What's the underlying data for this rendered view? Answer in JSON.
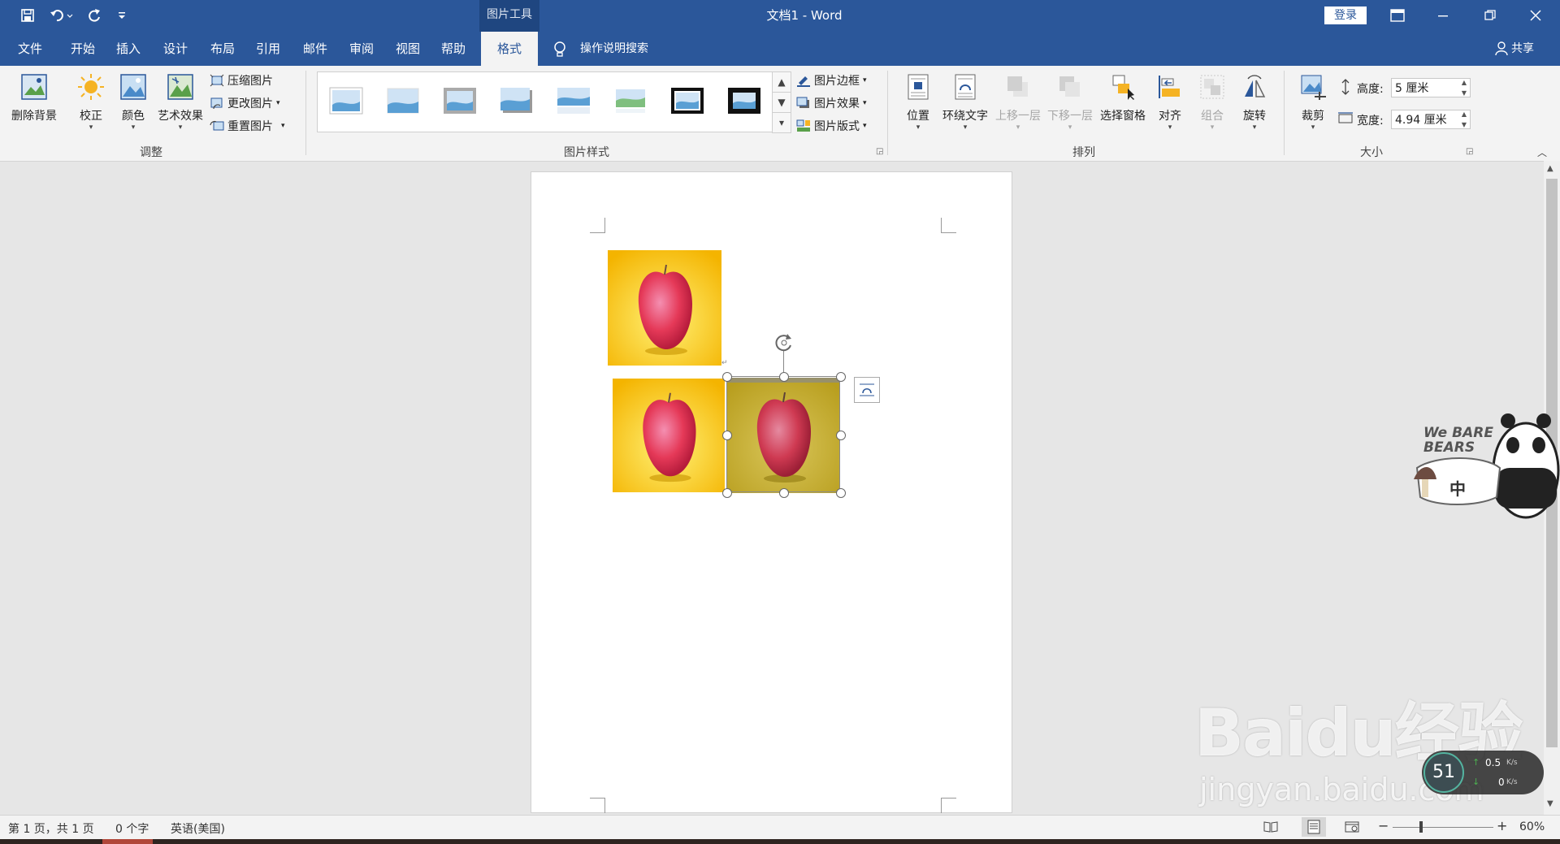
{
  "window": {
    "title": "文档1 - Word",
    "context_tab_group": "图片工具",
    "login_label": "登录"
  },
  "menu": {
    "tabs": [
      "文件",
      "开始",
      "插入",
      "设计",
      "布局",
      "引用",
      "邮件",
      "审阅",
      "视图",
      "帮助",
      "格式"
    ],
    "active_tab": "格式",
    "tell_me": "操作说明搜索",
    "share": "共享"
  },
  "ribbon": {
    "adjust": {
      "remove_bg": "删除背景",
      "corrections": "校正",
      "color": "颜色",
      "artistic": "艺术效果",
      "compress": "压缩图片",
      "change": "更改图片",
      "reset": "重置图片",
      "group_label": "调整"
    },
    "styles": {
      "border": "图片边框",
      "effects": "图片效果",
      "layout": "图片版式",
      "group_label": "图片样式"
    },
    "arrange": {
      "position": "位置",
      "wrap": "环绕文字",
      "forward": "上移一层",
      "backward": "下移一层",
      "selection_pane": "选择窗格",
      "align": "对齐",
      "group": "组合",
      "rotate": "旋转",
      "group_label": "排列"
    },
    "size": {
      "crop": "裁剪",
      "height_label": "高度:",
      "height_value": "5 厘米",
      "width_label": "宽度:",
      "width_value": "4.94 厘米",
      "group_label": "大小"
    }
  },
  "status": {
    "page": "第 1 页，共 1 页",
    "words": "0 个字",
    "language": "英语(美国)",
    "zoom": "60%"
  },
  "overlay": {
    "sticker_text": "中",
    "sticker_brand": "We BARE BEARS",
    "net_percent": "51",
    "net_up": "0.5",
    "net_down": "0",
    "net_unit": "K/s",
    "watermark": "Baidu经验",
    "watermark_url": "jingyan.baidu.com"
  },
  "colors": {
    "accent": "#2b579a",
    "apple_bg": "#f6c418",
    "apple_bg_selected": "#cdb232"
  }
}
